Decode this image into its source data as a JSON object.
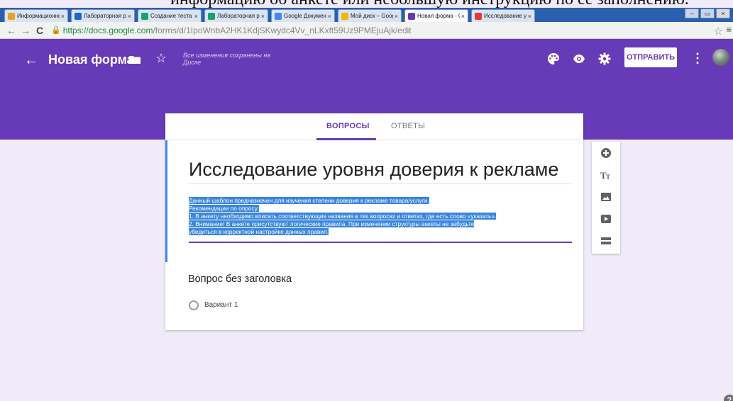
{
  "doc_overlay_text": "информацию об анкете или небольшую инструкцию по ее заполнению.",
  "browser": {
    "tabs": [
      {
        "label": "Информационные",
        "color": "#e8a21c"
      },
      {
        "label": "Лабораторная ра",
        "color": "#1e66c9"
      },
      {
        "label": "Создание теста с",
        "color": "#1aa36b"
      },
      {
        "label": "Лабораторная ра",
        "color": "#1aa36b"
      },
      {
        "label": "Google Документы",
        "color": "#4285f4"
      },
      {
        "label": "Мой диск – Google",
        "color": "#f4b400"
      },
      {
        "label": "Новая форма - Go",
        "color": "#673ab7",
        "active": true
      },
      {
        "label": "Исследование ур",
        "color": "#e53935"
      }
    ],
    "url_secure": "https://docs.google.com",
    "url_path": "/forms/d/1IpoWnbA2HK1KdjSKwydc4Vv_nLKxft59Uz9PMEjuAjk/edit"
  },
  "header": {
    "form_title": "Новая форма",
    "save_status": "Все изменения сохранены на Диске",
    "send_label": "ОТПРАВИТЬ",
    "accent": "#673ab7"
  },
  "tabs": {
    "questions": "ВОПРОСЫ",
    "answers": "ОТВЕТЫ"
  },
  "form": {
    "heading": "Исследование уровня доверия к рекламе",
    "description_lines": [
      "Данный шаблон предназначен для изучения степени доверия к рекламе товара/услуги.",
      "Рекомендации по опросу:",
      "1. В анкету необходимо вписать соответствующие названия в тех вопросах и ответах, где есть слово «указать».",
      "2. Внимание! В анкете присутствуют логические правила. При изменении структуры анкеты не забудьте",
      "убедиться в корректной настройке данных правил."
    ]
  },
  "question": {
    "title": "Вопрос без заголовка",
    "option": "Вариант 1"
  },
  "side_toolbar": [
    "add-question-icon",
    "title-text-icon",
    "image-icon",
    "video-icon",
    "section-icon"
  ],
  "help": "?"
}
